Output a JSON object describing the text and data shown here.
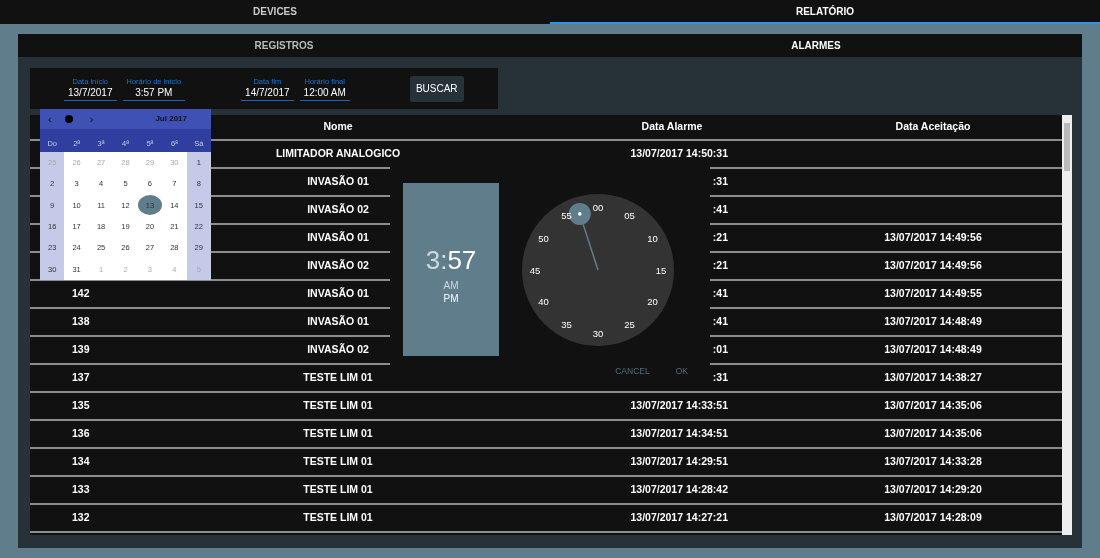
{
  "tabs": [
    {
      "label": "DEVICES",
      "selected": false
    },
    {
      "label": "RELATÓRIO",
      "selected": true
    }
  ],
  "subtabs": [
    {
      "label": "REGISTROS",
      "selected": false
    },
    {
      "label": "ALARMES",
      "selected": true
    }
  ],
  "filters": {
    "groups": [
      [
        {
          "label": "Data início",
          "value": "13/7/2017"
        },
        {
          "label": "Horário de início",
          "value": "3:57 PM"
        }
      ],
      [
        {
          "label": "Data fim",
          "value": "14/7/2017"
        },
        {
          "label": "Horário final",
          "value": "12:00 AM"
        }
      ]
    ],
    "search_button": "BUSCAR"
  },
  "table": {
    "columns": [
      "Nome",
      "Data Alarme",
      "Data Aceitação"
    ],
    "rows": [
      {
        "nome": "LIMITADOR ANALOGICO",
        "data_alarme": "13/07/2017 14:50:31"
      },
      {
        "nome": "INVASÃO 01",
        "data_alarme": ":31"
      },
      {
        "nome": "INVASÃO 02",
        "data_alarme": ":41"
      },
      {
        "nome": "INVASÃO 01",
        "data_alarme": ":21",
        "data_aceitacao": "13/07/2017 14:49:56"
      },
      {
        "nome": "INVASÃO 02",
        "data_alarme": ":21",
        "data_aceitacao": "13/07/2017 14:49:56"
      },
      {
        "column_1": "142",
        "nome": "INVASÃO 01",
        "data_alarme": ":41",
        "data_aceitacao": "13/07/2017 14:49:55"
      },
      {
        "column_1": "138",
        "nome": "INVASÃO 01",
        "data_alarme": ":41",
        "data_aceitacao": "13/07/2017 14:48:49"
      },
      {
        "column_1": "139",
        "nome": "INVASÃO 02",
        "data_alarme": ":01",
        "data_aceitacao": "13/07/2017 14:48:49"
      },
      {
        "column_1": "137",
        "nome": "TESTE LIM 01",
        "data_alarme": ":31",
        "data_aceitacao": "13/07/2017 14:38:27"
      },
      {
        "column_1": "135",
        "nome": "TESTE LIM 01",
        "data_alarme": "13/07/2017 14:33:51",
        "data_aceitacao": "13/07/2017 14:35:06"
      },
      {
        "column_1": "136",
        "nome": "TESTE LIM 01",
        "data_alarme": "13/07/2017 14:34:51",
        "data_aceitacao": "13/07/2017 14:35:06"
      },
      {
        "column_1": "134",
        "nome": "TESTE LIM 01",
        "data_alarme": "13/07/2017 14:29:51",
        "data_aceitacao": "13/07/2017 14:33:28"
      },
      {
        "column_1": "133",
        "nome": "TESTE LIM 01",
        "data_alarme": "13/07/2017 14:28:42",
        "data_aceitacao": "13/07/2017 14:29:20"
      },
      {
        "column_1": "132",
        "nome": "TESTE LIM 01",
        "data_alarme": "13/07/2017 14:27:21",
        "data_aceitacao": "13/07/2017 14:28:09"
      }
    ]
  },
  "date_picker": {
    "prev": "‹",
    "next": "›",
    "month": "Jul 2017",
    "weekdays": [
      "Do",
      "2ª",
      "3ª",
      "4ª",
      "5ª",
      "6ª",
      "Sá"
    ],
    "days": [
      {
        "day": "25",
        "kind": "other",
        "selected": false
      },
      {
        "day": "26",
        "kind": "other",
        "selected": false
      },
      {
        "day": "27",
        "kind": "other",
        "selected": false
      },
      {
        "day": "28",
        "kind": "other",
        "selected": false
      },
      {
        "day": "29",
        "kind": "other",
        "selected": false
      },
      {
        "day": "30",
        "kind": "other",
        "selected": false
      },
      {
        "day": "1",
        "kind": "current",
        "selected": false
      },
      {
        "day": "2",
        "kind": "current",
        "selected": false
      },
      {
        "day": "3",
        "kind": "current",
        "selected": false
      },
      {
        "day": "4",
        "kind": "current",
        "selected": false
      },
      {
        "day": "5",
        "kind": "current",
        "selected": false
      },
      {
        "day": "6",
        "kind": "current",
        "selected": false
      },
      {
        "day": "7",
        "kind": "current",
        "selected": false
      },
      {
        "day": "8",
        "kind": "current",
        "selected": false
      },
      {
        "day": "9",
        "kind": "current",
        "selected": false
      },
      {
        "day": "10",
        "kind": "current",
        "selected": false
      },
      {
        "day": "11",
        "kind": "current",
        "selected": false
      },
      {
        "day": "12",
        "kind": "current",
        "selected": false
      },
      {
        "day": "13",
        "kind": "current",
        "selected": true
      },
      {
        "day": "14",
        "kind": "current",
        "selected": false
      },
      {
        "day": "15",
        "kind": "current",
        "selected": false
      },
      {
        "day": "16",
        "kind": "current",
        "selected": false
      },
      {
        "day": "17",
        "kind": "current",
        "selected": false
      },
      {
        "day": "18",
        "kind": "current",
        "selected": false
      },
      {
        "day": "19",
        "kind": "current",
        "selected": false
      },
      {
        "day": "20",
        "kind": "current",
        "selected": false
      },
      {
        "day": "21",
        "kind": "current",
        "selected": false
      },
      {
        "day": "22",
        "kind": "current",
        "selected": false
      },
      {
        "day": "23",
        "kind": "current",
        "selected": false
      },
      {
        "day": "24",
        "kind": "current",
        "selected": false
      },
      {
        "day": "25",
        "kind": "current",
        "selected": false
      },
      {
        "day": "26",
        "kind": "current",
        "selected": false
      },
      {
        "day": "27",
        "kind": "current",
        "selected": false
      },
      {
        "day": "28",
        "kind": "current",
        "selected": false
      },
      {
        "day": "29",
        "kind": "current",
        "selected": false
      },
      {
        "day": "30",
        "kind": "current",
        "selected": false
      },
      {
        "day": "31",
        "kind": "current",
        "selected": false
      },
      {
        "day": "1",
        "kind": "other",
        "selected": false
      },
      {
        "day": "2",
        "kind": "other",
        "selected": false
      },
      {
        "day": "3",
        "kind": "other",
        "selected": false
      },
      {
        "day": "4",
        "kind": "other",
        "selected": false
      },
      {
        "day": "5",
        "kind": "other",
        "selected": false
      }
    ]
  },
  "time_picker": {
    "hour": {
      "text": "3",
      "selected": false
    },
    "separator": ":",
    "minute": {
      "text": "57",
      "selected": true
    },
    "periods": [
      {
        "label": "AM",
        "selected": false
      },
      {
        "label": "PM",
        "selected": true
      }
    ],
    "dial_numbers": [
      "00",
      "05",
      "10",
      "15",
      "20",
      "25",
      "30",
      "35",
      "40",
      "45",
      "50",
      "55"
    ],
    "hand": {
      "level": 0.95
    },
    "buttons": [
      "CANCEL",
      "OK"
    ]
  }
}
